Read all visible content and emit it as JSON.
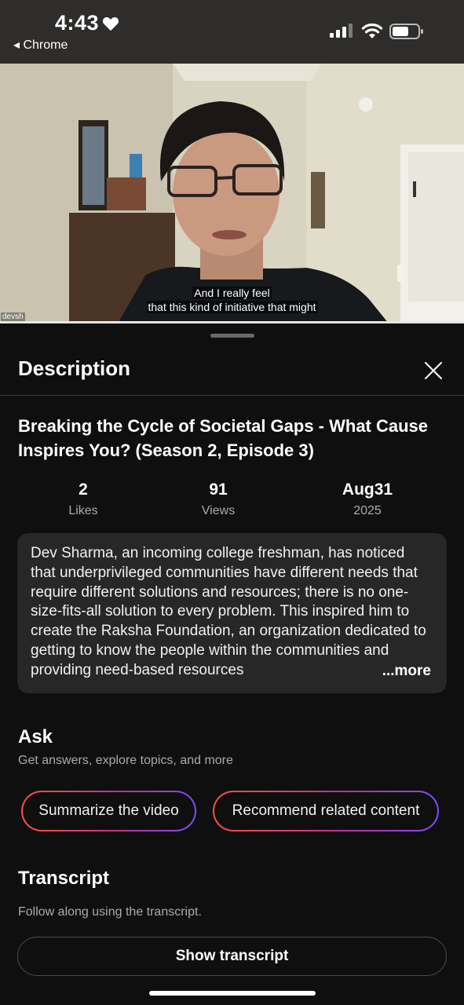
{
  "status_bar": {
    "time": "4:43",
    "back_app": "◂ Chrome"
  },
  "video": {
    "caption_line1": "And I really feel",
    "caption_line2": "that this kind of initiative that might",
    "watermark": "devsh"
  },
  "sheet": {
    "title": "Description",
    "video_title": "Breaking the Cycle of Societal Gaps - What Cause Inspires You? (Season 2, Episode 3)",
    "stats": [
      {
        "value": "2",
        "label": "Likes"
      },
      {
        "value": "91",
        "label": "Views"
      },
      {
        "value": "Aug31",
        "label": "2025"
      }
    ],
    "description": "Dev Sharma, an incoming college freshman, has noticed that underprivileged communities have different needs that require different solutions and resources; there is no one-size-fits-all solution to every problem. This inspired him to create the Raksha Foundation, an organization dedicated to getting to know the people within the communities and providing need-based resources",
    "more_label": "...more",
    "ask": {
      "title": "Ask",
      "subtitle": "Get answers, explore topics, and more",
      "chips": [
        "Summarize the video",
        "Recommend related content"
      ]
    },
    "transcript": {
      "title": "Transcript",
      "subtitle": "Follow along using the transcript.",
      "button_label": "Show transcript"
    }
  },
  "colors": {
    "background": "#0f0f0f",
    "card": "#272727",
    "chip_gradient_start": "#ff4e45",
    "chip_gradient_end": "#7b4bff"
  },
  "icons": [
    "heart-icon",
    "signal-icon",
    "wifi-icon",
    "battery-icon",
    "close-icon"
  ]
}
